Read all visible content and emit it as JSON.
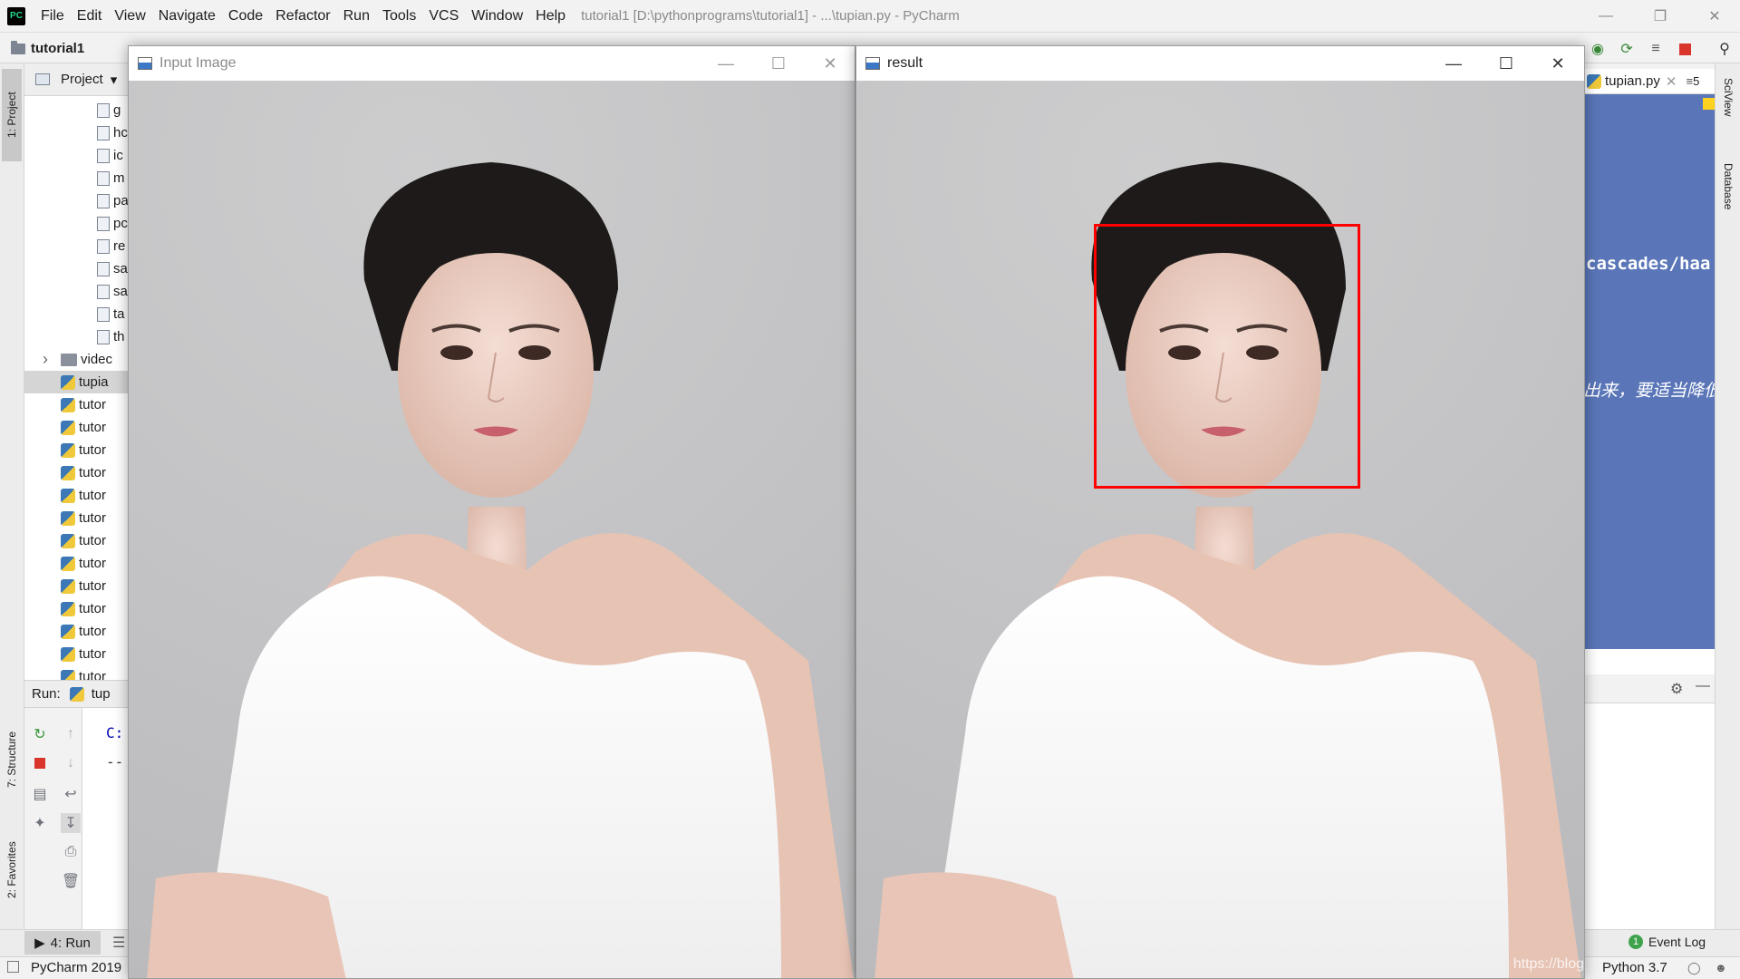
{
  "app": {
    "logo": "PC",
    "menu": [
      "File",
      "Edit",
      "View",
      "Navigate",
      "Code",
      "Refactor",
      "Run",
      "Tools",
      "VCS",
      "Window",
      "Help"
    ],
    "window_title": "tutorial1 [D:\\pythonprograms\\tutorial1] - ...\\tupian.py - PyCharm"
  },
  "navbar": {
    "project_name": "tutorial1"
  },
  "left_stripe": {
    "project_tab": "1: Project",
    "structure_tab": "7: Structure",
    "favorites_tab": "2: Favorites"
  },
  "project_panel": {
    "header": "Project",
    "files": [
      {
        "label": "g",
        "type": "file"
      },
      {
        "label": "hc",
        "type": "file"
      },
      {
        "label": "ic",
        "type": "file"
      },
      {
        "label": "m",
        "type": "file"
      },
      {
        "label": "pa",
        "type": "file"
      },
      {
        "label": "pc",
        "type": "file"
      },
      {
        "label": "re",
        "type": "file"
      },
      {
        "label": "sa",
        "type": "file"
      },
      {
        "label": "sa",
        "type": "file"
      },
      {
        "label": "ta",
        "type": "file"
      },
      {
        "label": "th",
        "type": "file"
      },
      {
        "label": "videc",
        "type": "folder"
      },
      {
        "label": "tupia",
        "type": "py",
        "selected": true
      },
      {
        "label": "tutor",
        "type": "py"
      },
      {
        "label": "tutor",
        "type": "py"
      },
      {
        "label": "tutor",
        "type": "py"
      },
      {
        "label": "tutor",
        "type": "py"
      },
      {
        "label": "tutor",
        "type": "py"
      },
      {
        "label": "tutor",
        "type": "py"
      },
      {
        "label": "tutor",
        "type": "py"
      },
      {
        "label": "tutor",
        "type": "py"
      },
      {
        "label": "tutor",
        "type": "py"
      },
      {
        "label": "tutor",
        "type": "py"
      },
      {
        "label": "tutor",
        "type": "py"
      },
      {
        "label": "tutor",
        "type": "py"
      },
      {
        "label": "tutor",
        "type": "py"
      }
    ]
  },
  "run_panel": {
    "label": "Run:",
    "tab": "tup",
    "console_lines": [
      "C:",
      "--"
    ]
  },
  "bottom": {
    "run_tab": "4: Run",
    "status_left": "PyCharm 2019",
    "event_log": "Event Log",
    "event_count": "1",
    "interpreter": "Python 3.7"
  },
  "editor": {
    "tab_label": "tupian.py",
    "tab_count": "5",
    "code_line_1": "cascades/haa",
    "code_line_2": "出来，要适当降低"
  },
  "right_stripe": {
    "sciview_tab": "SciView",
    "database_tab": "Database"
  },
  "windows": {
    "input": {
      "title": "Input Image"
    },
    "result": {
      "title": "result"
    }
  },
  "watermark": "https://blog",
  "colors": {
    "detection_box": "#ff0000",
    "editor_selection": "#5a76b8",
    "accent_green": "#21d789"
  }
}
